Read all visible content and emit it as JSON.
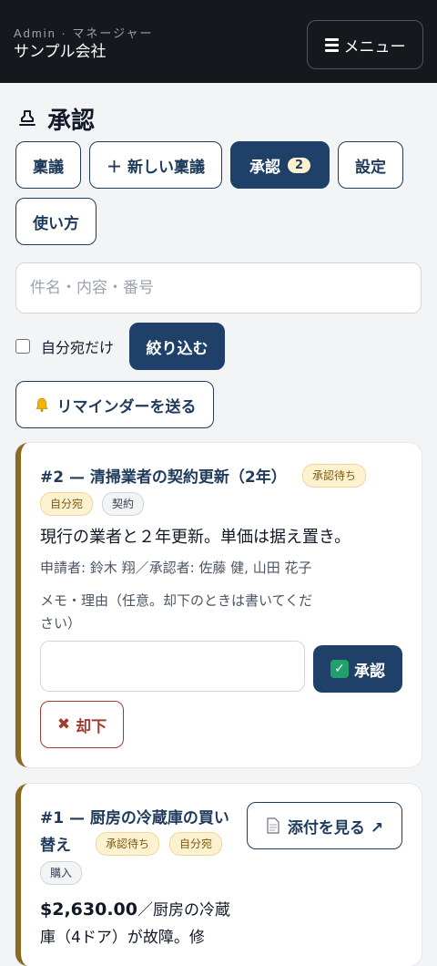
{
  "header": {
    "role": "Admin · マネージャー",
    "company": "サンプル会社",
    "menu_label": "メニュー"
  },
  "page": {
    "title": "承認"
  },
  "nav": {
    "ringi": "稟議",
    "new_ringi": "＋ 新しい稟議",
    "approval": "承認",
    "approval_count": "2",
    "settings": "設定",
    "howto": "使い方"
  },
  "filters": {
    "search_placeholder": "件名・内容・番号",
    "search_value": "",
    "mine_only_label": "自分宛だけ",
    "filter_button": "絞り込む",
    "reminder_button": "リマインダーを送る"
  },
  "colors": {
    "primary": "#1f4068",
    "accent_border": "#8a6a1f",
    "reject": "#a33b2e"
  },
  "cards": [
    {
      "title": "#2 — 清掃業者の契約更新（2年）",
      "status": "承認待ち",
      "tags": [
        "自分宛",
        "契約"
      ],
      "description": "現行の業者と２年更新。単価は据え置き。",
      "meta": "申請者: 鈴木 翔／承認者: 佐藤 健, 山田 花子",
      "memo_label": "メモ・理由（任意。却下のときは書いてください）",
      "memo_value": "",
      "approve_label": "承認",
      "reject_label": "却下"
    },
    {
      "title": "#1 — 厨房の冷蔵庫の買い替え",
      "status": "承認待ち",
      "tags": [
        "自分宛",
        "購入"
      ],
      "attachment_label": "添付を見る ↗",
      "amount": "$2,630.00",
      "description": "／厨房の冷蔵庫（4ドア）が故障。修"
    }
  ]
}
